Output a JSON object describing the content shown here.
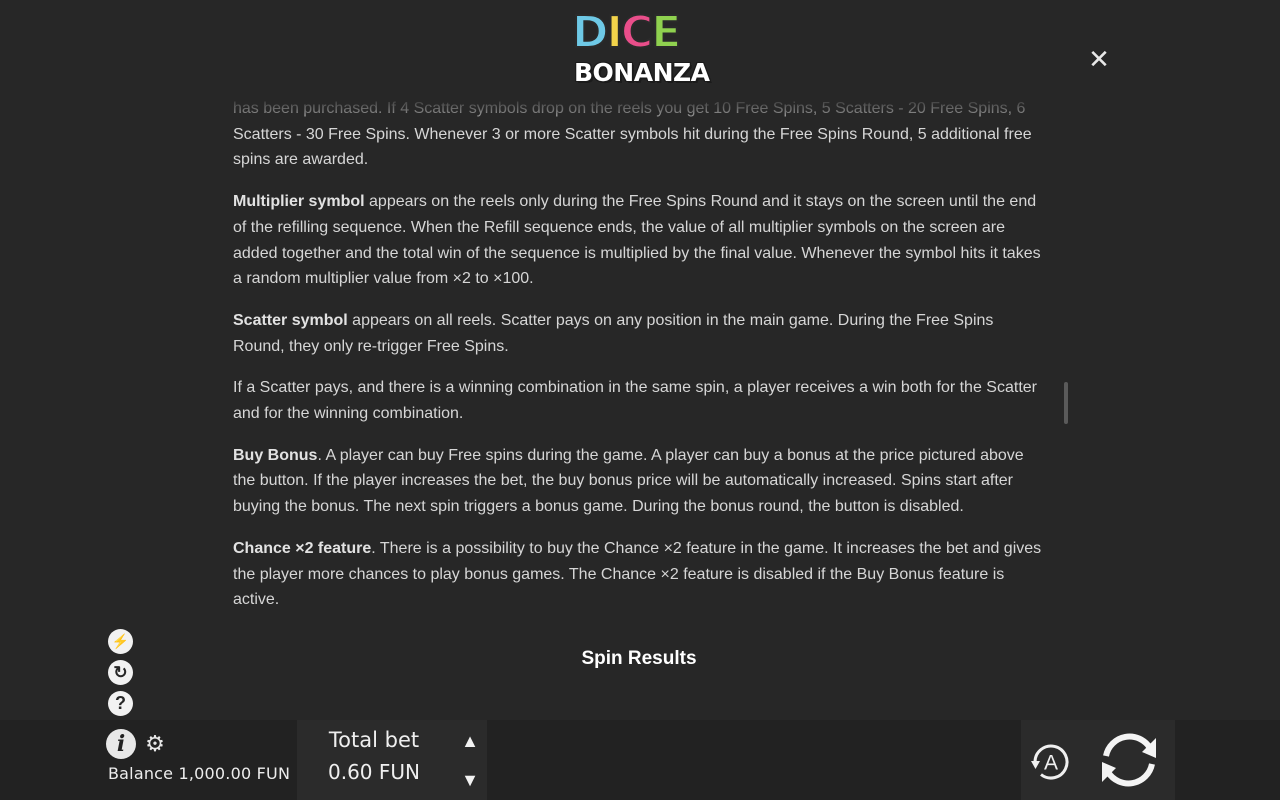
{
  "logo": {
    "line1_letters": [
      "D",
      "I",
      "C",
      "E"
    ],
    "line1_colors": [
      "#6ec9e6",
      "#f2d34a",
      "#e94e8a",
      "#8fd14f"
    ],
    "line2": "BONANZA"
  },
  "close": {
    "glyph": "✕",
    "icon": "close-icon"
  },
  "content": {
    "p1": "has been purchased. If 4 Scatter symbols drop on the reels you get 10 Free Spins, 5 Scatters - 20 Free Spins, 6 Scatters - 30 Free Spins. Whenever 3 or more Scatter symbols hit during the Free Spins Round, 5 additional free spins are awarded.",
    "p2_bold": "Multiplier symbol",
    "p2_text": " appears on the reels only during the Free Spins Round and it stays on the screen until the end of the refilling sequence. When the Refill sequence ends, the value of all multiplier symbols on the screen are added together and the total win of the sequence is multiplied by the final value. Whenever the symbol hits it takes a random multiplier value from ×2 to ×100.",
    "p3_bold": "Scatter symbol",
    "p3_text": " appears on all reels. Scatter pays on any position in the main game. During the Free Spins Round, they only re-trigger Free Spins.",
    "p4": "If a Scatter pays, and there is a winning combination in the same spin, a player receives a win both for the Scatter and for the winning combination.",
    "p5_bold": "Buy Bonus",
    "p5_text": ". A player can buy Free spins during the game. A player can buy a bonus at the price pictured above the button. If the player increases the bet, the buy bonus price will be automatically increased. Spins start after buying the bonus. The next spin triggers a bonus game. During the bonus round, the button is disabled.",
    "p6_bold": "Chance ×2 feature",
    "p6_text": ". There is a possibility to buy the Chance ×2 feature in the game. It increases the bet and gives the player more chances to play bonus games. The Chance ×2 feature is disabled if the Buy Bonus feature is active.",
    "section_title": "Spin Results"
  },
  "side_icons": [
    {
      "icon": "turbo-spin-icon",
      "glyph": "⚡"
    },
    {
      "icon": "quick-spin-icon",
      "glyph": "↻"
    },
    {
      "icon": "help-icon",
      "glyph": "?"
    }
  ],
  "bottom": {
    "info_glyph": "i",
    "gear_glyph": "⚙",
    "balance": "Balance 1,000.00 FUN",
    "bet_label": "Total bet",
    "bet_value": "0.60 FUN",
    "arrow_up": "▲",
    "arrow_down": "▼",
    "autoplay_letter": "A"
  }
}
